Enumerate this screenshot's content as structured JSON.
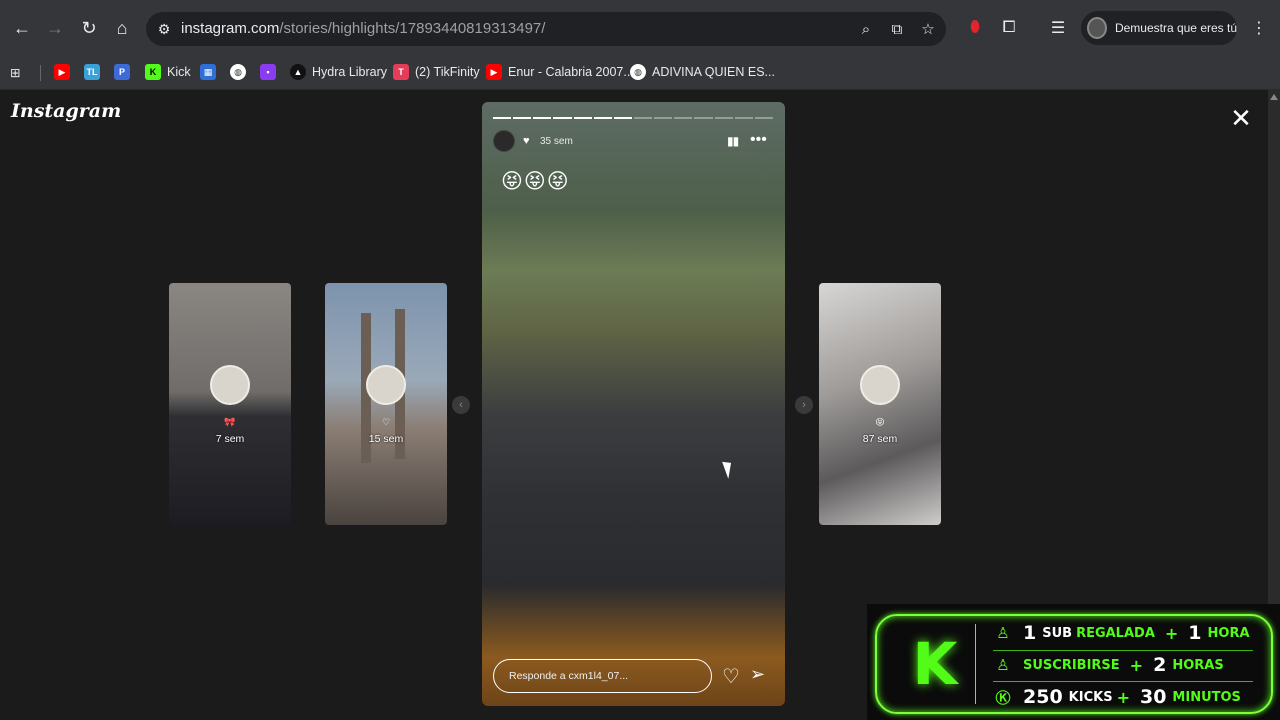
{
  "browser": {
    "url_host": "instagram.com",
    "url_path": "/stories/highlights/17893440819313497/",
    "profile_label": "Demuestra que eres tú",
    "bookmarks": [
      {
        "label": "",
        "color": "#ff0000",
        "icon": "youtube-icon"
      },
      {
        "label": "",
        "color": "#3aa0d8",
        "icon": "tl-icon",
        "glyph": "TL"
      },
      {
        "label": "",
        "color": "#3c6ad8",
        "icon": "p-icon",
        "glyph": "P"
      },
      {
        "label": "Kick",
        "color": "#53fc18",
        "icon": "kick-icon",
        "glyph": "K"
      },
      {
        "label": "",
        "color": "#2f6fd8",
        "icon": "grid-icon"
      },
      {
        "label": "",
        "color": "#ffffff",
        "icon": "globe-icon"
      },
      {
        "label": "",
        "color": "#8a3cf0",
        "icon": "square-icon"
      },
      {
        "label": "Hydra Library",
        "color": "#111111",
        "icon": "hydra-icon"
      },
      {
        "label": "(2) TikFinity",
        "color": "#e63c5a",
        "icon": "tikfinity-icon",
        "glyph": "T"
      },
      {
        "label": "Enur - Calabria 2007...",
        "color": "#ff0000",
        "icon": "youtube-icon"
      },
      {
        "label": "ADIVINA QUIEN ES...",
        "color": "#ffffff",
        "icon": "globe-icon"
      }
    ]
  },
  "instagram": {
    "logo": "Instagram",
    "close_glyph": "✕",
    "thumbs": [
      {
        "age": "7 sem"
      },
      {
        "age": "15 sem"
      },
      {
        "age": "87 sem"
      }
    ],
    "story": {
      "segments_total": 14,
      "segments_done": 7,
      "age": "35 sem",
      "emojis": "😝😝😝",
      "reply_placeholder": "Responde a cxm1l4_07..."
    }
  },
  "overlay": {
    "rows": [
      {
        "num": "1",
        "word": "SUB",
        "accent": "REGALADA",
        "num2": "1",
        "accent2": "HORA"
      },
      {
        "num": "",
        "word": "",
        "accent": "SUSCRIBIRSE",
        "num2": "2",
        "accent2": "HORAS"
      },
      {
        "num": "250",
        "word": "KICKS",
        "accent": "",
        "num2": "30",
        "accent2": "MINUTOS"
      }
    ],
    "accent_color": "#53fc18"
  }
}
